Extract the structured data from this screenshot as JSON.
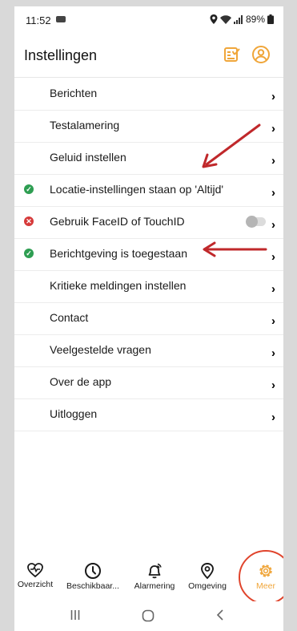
{
  "status": {
    "time": "11:52",
    "battery": "89%"
  },
  "header": {
    "title": "Instellingen"
  },
  "settings": [
    {
      "label": "Berichten",
      "chevron": "›"
    },
    {
      "label": "Testalamering",
      "chevron": "›"
    },
    {
      "label": "Geluid instellen",
      "chevron": "›"
    },
    {
      "label": "Locatie-instellingen staan op 'Altijd'",
      "chevron": "›",
      "status": "ok",
      "status_icon": "check-circle-icon",
      "status_glyph": "✓"
    },
    {
      "label": "Gebruik FaceID of TouchID",
      "chevron": "›",
      "status": "error",
      "status_icon": "error-circle-icon",
      "status_glyph": "✕",
      "toggle_on": false
    },
    {
      "label": "Berichtgeving is toegestaan",
      "chevron": "›",
      "status": "ok",
      "status_icon": "check-circle-icon",
      "status_glyph": "✓"
    },
    {
      "label": "Kritieke meldingen instellen",
      "chevron": "›"
    },
    {
      "label": "Contact",
      "chevron": "›"
    },
    {
      "label": "Veelgestelde vragen",
      "chevron": "›"
    },
    {
      "label": "Over de app",
      "chevron": "›"
    },
    {
      "label": "Uitloggen",
      "chevron": "›"
    }
  ],
  "nav": [
    {
      "label": "Overzicht",
      "icon": "heart-pulse-icon"
    },
    {
      "label": "Beschikbaar...",
      "icon": "clock-icon"
    },
    {
      "label": "Alarmering",
      "icon": "bell-icon"
    },
    {
      "label": "Omgeving",
      "icon": "location-pin-icon"
    },
    {
      "label": "Meer",
      "icon": "gear-icon",
      "active": true
    }
  ],
  "colors": {
    "accent": "#f0a63a",
    "ok": "#2e9e52",
    "error": "#d63a3a",
    "annotation": "#c0282b"
  }
}
